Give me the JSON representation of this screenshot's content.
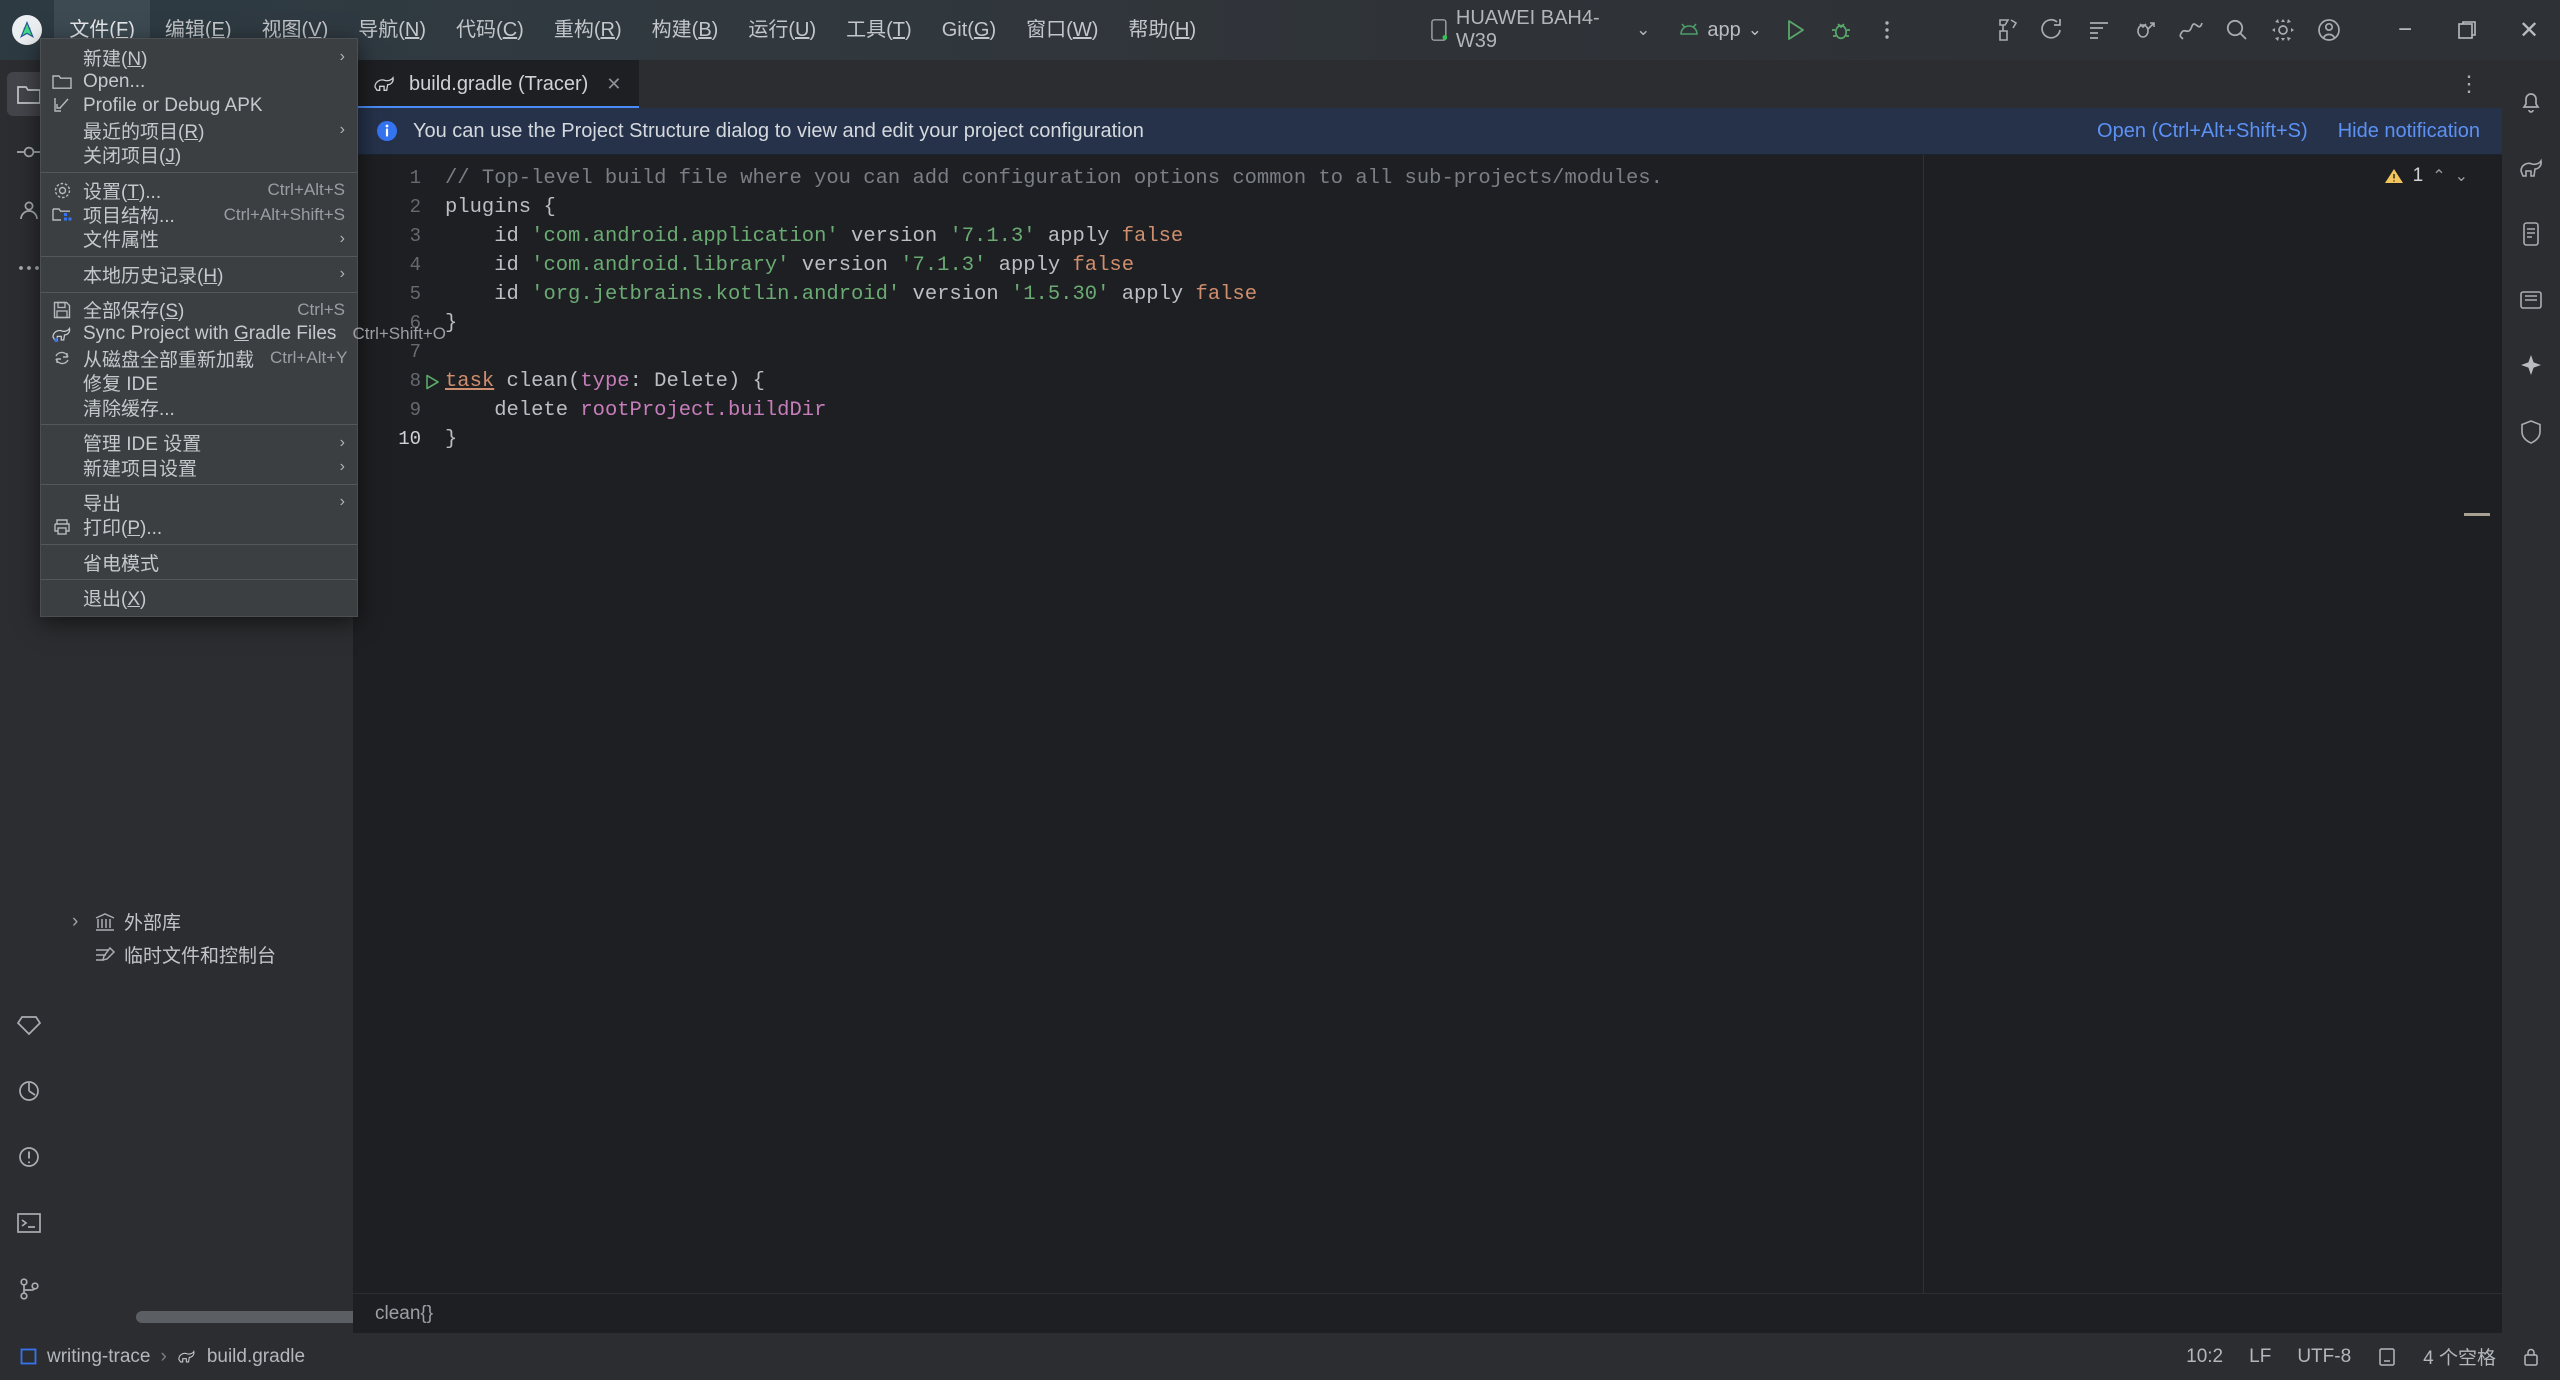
{
  "window": {
    "app_icon": "android-studio-logo-icon",
    "minimize": "−",
    "restore": "❐",
    "close": "✕"
  },
  "menubar": {
    "items": [
      {
        "label": "文件(F)",
        "mnemonic": "F",
        "active": true
      },
      {
        "label": "编辑(E)",
        "mnemonic": "E",
        "active": false
      },
      {
        "label": "视图(V)",
        "mnemonic": "V",
        "active": false
      },
      {
        "label": "导航(N)",
        "mnemonic": "N",
        "active": false
      },
      {
        "label": "代码(C)",
        "mnemonic": "C",
        "active": false
      },
      {
        "label": "重构(R)",
        "mnemonic": "R",
        "active": false
      },
      {
        "label": "构建(B)",
        "mnemonic": "B",
        "active": false
      },
      {
        "label": "运行(U)",
        "mnemonic": "U",
        "active": false
      },
      {
        "label": "工具(T)",
        "mnemonic": "T",
        "active": false
      },
      {
        "label": "Git(G)",
        "mnemonic": "G",
        "active": false
      },
      {
        "label": "窗口(W)",
        "mnemonic": "W",
        "active": false
      },
      {
        "label": "帮助(H)",
        "mnemonic": "H",
        "active": false
      }
    ]
  },
  "toolbar": {
    "device_label": "HUAWEI BAH4-W39",
    "device_chevron": "⌄",
    "run_config_label": "app",
    "run_config_chevron": "⌄",
    "run_button": "run-button",
    "debug_button": "debug-button",
    "more_button": "more-actions-button",
    "icons": [
      "build-hammer-icon",
      "sync-gradle-icon",
      "avd-manager-icon",
      "sdk-manager-icon",
      "profiler-icon",
      "search-everywhere-icon",
      "settings-gear-icon",
      "account-icon"
    ]
  },
  "file_menu": {
    "groups": [
      [
        {
          "label": "新建(N)",
          "mnemonic": "N",
          "icon": null,
          "shortcut": "",
          "submenu": true
        },
        {
          "label": "Open...",
          "mnemonic": "",
          "icon": "folder-icon",
          "shortcut": "",
          "submenu": false
        },
        {
          "label": "Profile or Debug APK",
          "mnemonic": "",
          "icon": "profile-apk-icon",
          "shortcut": "",
          "submenu": false
        },
        {
          "label": "最近的项目(R)",
          "mnemonic": "R",
          "icon": null,
          "shortcut": "",
          "submenu": true
        },
        {
          "label": "关闭项目(J)",
          "mnemonic": "J",
          "icon": null,
          "shortcut": "",
          "submenu": false
        }
      ],
      [
        {
          "label": "设置(T)...",
          "mnemonic": "T",
          "icon": "gear-icon",
          "shortcut": "Ctrl+Alt+S",
          "submenu": false
        },
        {
          "label": "项目结构...",
          "mnemonic": "",
          "icon": "project-structure-icon",
          "shortcut": "Ctrl+Alt+Shift+S",
          "submenu": false
        },
        {
          "label": "文件属性",
          "mnemonic": "",
          "icon": null,
          "shortcut": "",
          "submenu": true
        }
      ],
      [
        {
          "label": "本地历史记录(H)",
          "mnemonic": "H",
          "icon": null,
          "shortcut": "",
          "submenu": true
        }
      ],
      [
        {
          "label": "全部保存(S)",
          "mnemonic": "S",
          "icon": "save-icon",
          "shortcut": "Ctrl+S",
          "submenu": false
        },
        {
          "label": "Sync Project with Gradle Files",
          "mnemonic": "G",
          "icon": "gradle-sync-icon",
          "shortcut": "Ctrl+Shift+O",
          "submenu": false
        },
        {
          "label": "从磁盘全部重新加载",
          "mnemonic": "",
          "icon": "reload-icon",
          "shortcut": "Ctrl+Alt+Y",
          "submenu": false
        },
        {
          "label": "修复 IDE",
          "mnemonic": "",
          "icon": null,
          "shortcut": "",
          "submenu": false
        },
        {
          "label": "清除缓存...",
          "mnemonic": "",
          "icon": null,
          "shortcut": "",
          "submenu": false
        }
      ],
      [
        {
          "label": "管理 IDE 设置",
          "mnemonic": "",
          "icon": null,
          "shortcut": "",
          "submenu": true
        },
        {
          "label": "新建项目设置",
          "mnemonic": "",
          "icon": null,
          "shortcut": "",
          "submenu": true
        }
      ],
      [
        {
          "label": "导出",
          "mnemonic": "",
          "icon": null,
          "shortcut": "",
          "submenu": true
        },
        {
          "label": "打印(P)...",
          "mnemonic": "P",
          "icon": "print-icon",
          "shortcut": "",
          "submenu": false
        }
      ],
      [
        {
          "label": "省电模式",
          "mnemonic": "",
          "icon": null,
          "shortcut": "",
          "submenu": false
        }
      ],
      [
        {
          "label": "退出(X)",
          "mnemonic": "X",
          "icon": null,
          "shortcut": "",
          "submenu": false
        }
      ]
    ]
  },
  "project_pane": {
    "rows": [
      {
        "label": "外部库",
        "icon": "library-icon",
        "arrow": "›"
      },
      {
        "label": "临时文件和控制台",
        "icon": "scratches-icon",
        "arrow": ""
      }
    ]
  },
  "editor": {
    "tab": {
      "title": "build.gradle (Tracer)",
      "icon": "gradle-file-icon",
      "close": "✕"
    },
    "tab_overflow_chevron": "›",
    "tab_options": "⋮",
    "notification": {
      "icon": "info-icon",
      "text": "You can use the Project Structure dialog to view and edit your project configuration",
      "open_link": "Open (Ctrl+Alt+Shift+S)",
      "hide_link": "Hide notification"
    },
    "inspections": {
      "count": "1",
      "warning_icon": "warning-triangle-icon",
      "up": "⌃",
      "down": "⌄"
    },
    "line_numbers": [
      "1",
      "2",
      "3",
      "4",
      "5",
      "6",
      "7",
      "8",
      "9",
      "10"
    ],
    "code_lines": [
      "// Top-level build file where you can add configuration options common to all sub-projects/modules.",
      "plugins {",
      "    id 'com.android.application' version '7.1.3' apply false",
      "    id 'com.android.library' version '7.1.3' apply false",
      "    id 'org.jetbrains.kotlin.android' version '1.5.30' apply false",
      "}",
      "",
      "task clean(type: Delete) {",
      "    delete rootProject.buildDir",
      "}"
    ],
    "run_marker_line": 8,
    "breadcrumb": "clean{}"
  },
  "statusbar": {
    "project_icon": "module-icon",
    "project": "writing-trace",
    "separator": "›",
    "file_icon": "gradle-file-icon",
    "file": "build.gradle",
    "caret": "10:2",
    "line_ending": "LF",
    "encoding": "UTF-8",
    "read_only_icon": "read-only-icon",
    "indent": "4 个空格",
    "lock_icon": "lock-icon"
  }
}
